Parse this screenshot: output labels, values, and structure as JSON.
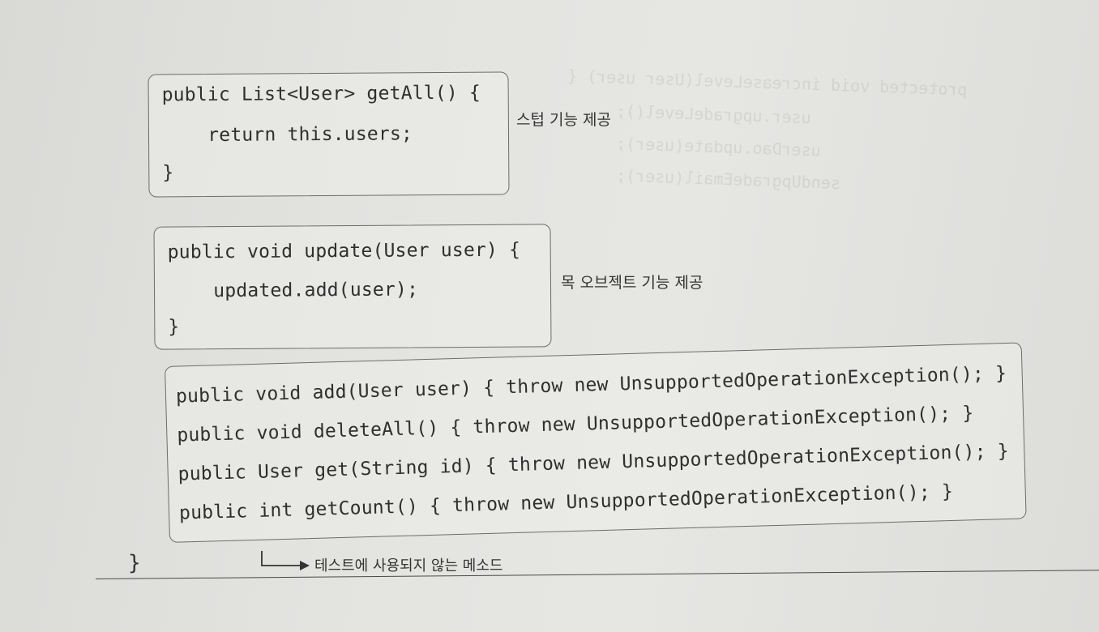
{
  "box1": {
    "lines": [
      "public List<User> getAll() {",
      "    return this.users;",
      "}"
    ],
    "annotation": "스텁 기능 제공"
  },
  "box2": {
    "lines": [
      "public void update(User user) {",
      "    updated.add(user);",
      "}"
    ],
    "annotation": "목 오브젝트 기능 제공"
  },
  "box3": {
    "lines": [
      "public void add(User user) { throw new UnsupportedOperationException(); }",
      "public void deleteAll() { throw new UnsupportedOperationException(); }",
      "public User get(String id) { throw new UnsupportedOperationException(); }",
      "public int getCount() { throw new UnsupportedOperationException(); }"
    ],
    "annotation": "테스트에 사용되지 않는 메소드"
  },
  "closing_brace": "}",
  "colors": {
    "ink": "#2f2f2f",
    "paper": "#e3e3e0",
    "border": "#6c6c6c"
  },
  "icons": {
    "pointer": "bent-arrow-icon"
  }
}
